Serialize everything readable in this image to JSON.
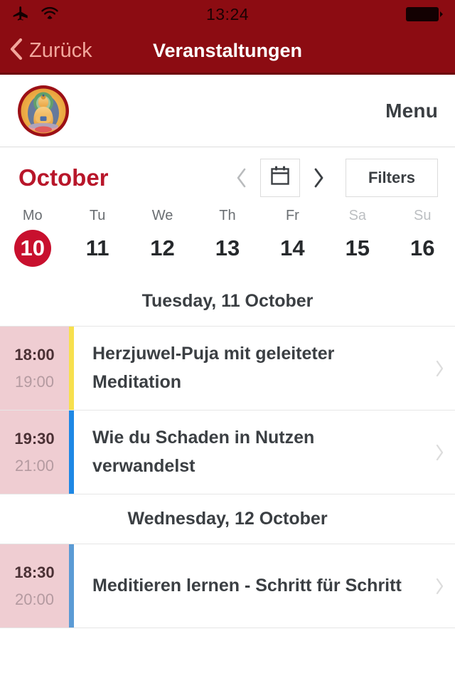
{
  "status_bar": {
    "time": "13:24",
    "icons": [
      "airplane-mode-icon",
      "wifi-icon",
      "battery-icon"
    ]
  },
  "nav_bar": {
    "back_label": "Zurück",
    "title": "Veranstaltungen"
  },
  "logo_bar": {
    "logo_alt": "buddha-logo",
    "menu_label": "Menu"
  },
  "toolbar": {
    "month": "October",
    "prev_label": "‹",
    "next_label": "›",
    "calendar_icon": "calendar-icon",
    "filters_label": "Filters"
  },
  "week": {
    "days": [
      {
        "label": "Mo",
        "num": "10",
        "selected": true,
        "weekend": false
      },
      {
        "label": "Tu",
        "num": "11",
        "selected": false,
        "weekend": false
      },
      {
        "label": "We",
        "num": "12",
        "selected": false,
        "weekend": false
      },
      {
        "label": "Th",
        "num": "13",
        "selected": false,
        "weekend": false
      },
      {
        "label": "Fr",
        "num": "14",
        "selected": false,
        "weekend": false
      },
      {
        "label": "Sa",
        "num": "15",
        "selected": false,
        "weekend": true
      },
      {
        "label": "Su",
        "num": "16",
        "selected": false,
        "weekend": true
      }
    ]
  },
  "agenda": [
    {
      "day_header": "Tuesday, 11 October",
      "events": [
        {
          "start": "18:00",
          "end": "19:00",
          "title": "Herzjuwel-Puja mit geleiteter Meditation",
          "accent": "#f7e04e"
        },
        {
          "start": "19:30",
          "end": "21:00",
          "title": "Wie du Schaden in Nutzen verwandelst",
          "accent": "#1e88e5"
        }
      ]
    },
    {
      "day_header": "Wednesday, 12 October",
      "events": [
        {
          "start": "18:30",
          "end": "20:00",
          "title": "Meditieren lernen - Schritt für Schritt",
          "accent": "#5b9bd5"
        }
      ]
    }
  ],
  "colors": {
    "header_red": "#8c0c12",
    "accent_red": "#c8102e",
    "month_red": "#b8162a",
    "time_pink": "#efcdd2",
    "back_salmon": "#f2a79c"
  }
}
